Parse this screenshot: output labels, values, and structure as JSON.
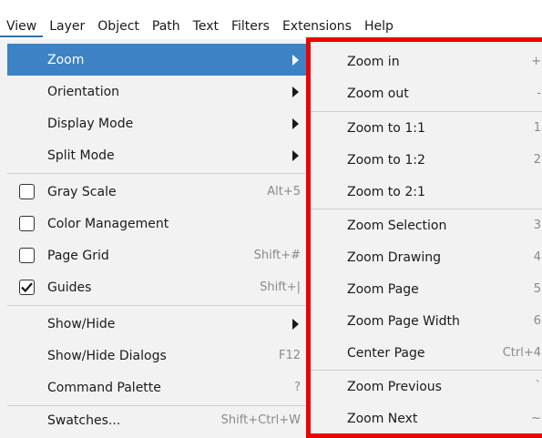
{
  "menubar": {
    "items": [
      "View",
      "Layer",
      "Object",
      "Path",
      "Text",
      "Filters",
      "Extensions",
      "Help"
    ],
    "active": "View"
  },
  "main_menu": {
    "items": [
      {
        "label": "Zoom",
        "submenu": true,
        "highlighted": true
      },
      {
        "label": "Orientation",
        "submenu": true
      },
      {
        "label": "Display Mode",
        "submenu": true
      },
      {
        "label": "Split Mode",
        "submenu": true
      },
      {
        "label": "Gray Scale",
        "checkbox": true,
        "checked": false,
        "shortcut": "Alt+5"
      },
      {
        "label": "Color Management",
        "checkbox": true,
        "checked": false
      },
      {
        "label": "Page Grid",
        "checkbox": true,
        "checked": false,
        "shortcut": "Shift+#"
      },
      {
        "label": "Guides",
        "checkbox": true,
        "checked": true,
        "shortcut": "Shift+|"
      },
      {
        "label": "Show/Hide",
        "submenu": true
      },
      {
        "label": "Show/Hide Dialogs",
        "shortcut": "F12"
      },
      {
        "label": "Command Palette",
        "shortcut": "?"
      },
      {
        "label": "Swatches...",
        "shortcut": "Shift+Ctrl+W"
      }
    ]
  },
  "zoom_submenu": {
    "items": [
      {
        "label": "Zoom in",
        "shortcut": "+"
      },
      {
        "label": "Zoom out",
        "shortcut": "-"
      },
      {
        "label": "Zoom to 1:1",
        "shortcut": "1"
      },
      {
        "label": "Zoom to 1:2",
        "shortcut": "2"
      },
      {
        "label": "Zoom to 2:1",
        "shortcut": ""
      },
      {
        "label": "Zoom Selection",
        "shortcut": "3"
      },
      {
        "label": "Zoom Drawing",
        "shortcut": "4"
      },
      {
        "label": "Zoom Page",
        "shortcut": "5"
      },
      {
        "label": "Zoom Page Width",
        "shortcut": "6"
      },
      {
        "label": "Center Page",
        "shortcut": "Ctrl+4"
      },
      {
        "label": "Zoom Previous",
        "shortcut": "`"
      },
      {
        "label": "Zoom Next",
        "shortcut": "~"
      }
    ]
  },
  "colors": {
    "highlight": "#3c82c5",
    "annotation_box": "#ee0000",
    "menu_bg": "#f2f2f2"
  }
}
